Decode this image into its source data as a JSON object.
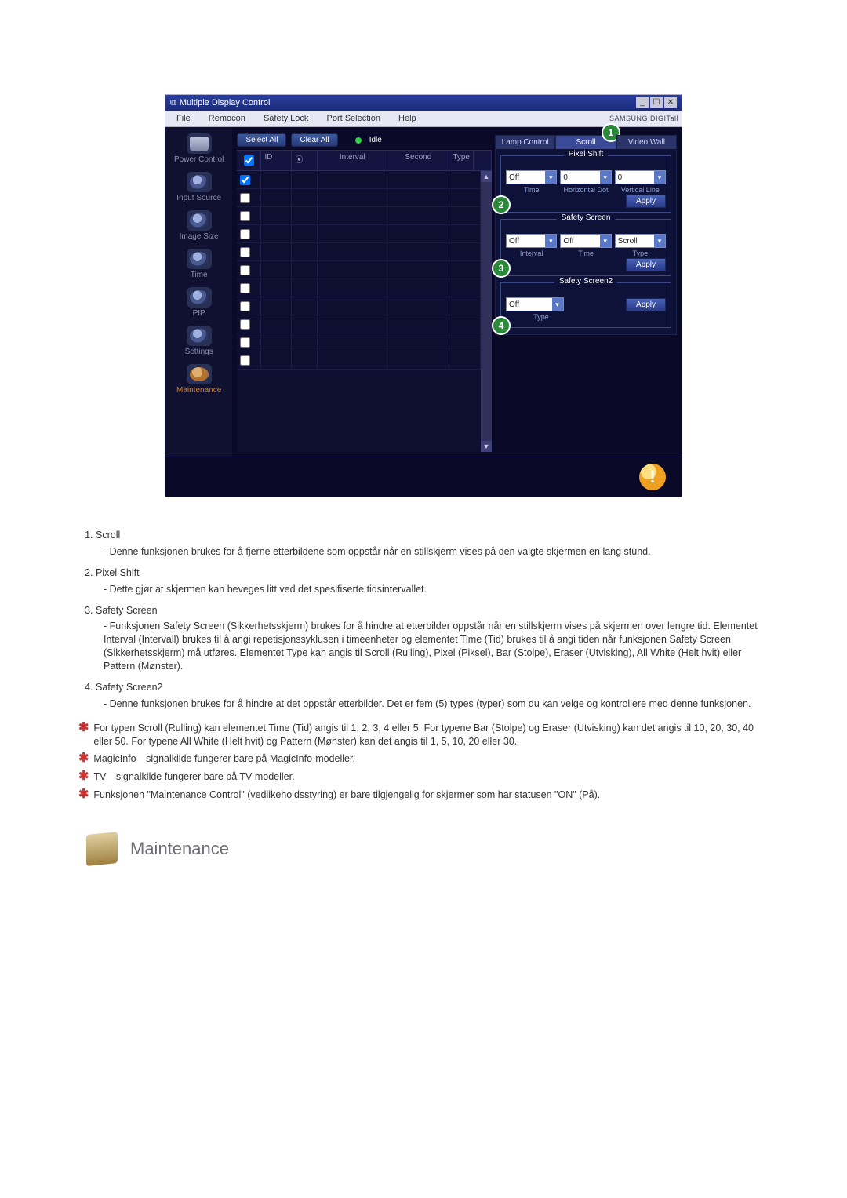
{
  "window": {
    "title": "Multiple Display Control",
    "sysbuttons": [
      "_",
      "☐",
      "✕"
    ]
  },
  "menu": {
    "items": [
      "File",
      "Remocon",
      "Safety Lock",
      "Port Selection",
      "Help"
    ],
    "brand": "SAMSUNG DIGITall"
  },
  "sidebar": {
    "items": [
      {
        "label": "Power Control"
      },
      {
        "label": "Input Source"
      },
      {
        "label": "Image Size"
      },
      {
        "label": "Time"
      },
      {
        "label": "PIP"
      },
      {
        "label": "Settings"
      },
      {
        "label": "Maintenance"
      }
    ]
  },
  "toolbar": {
    "select_all": "Select All",
    "clear_all": "Clear All",
    "status": "Idle"
  },
  "grid": {
    "headers": {
      "id": "ID",
      "interval": "Interval",
      "second": "Second",
      "type": "Type"
    },
    "row_count": 11,
    "first_row_checked": true
  },
  "tabs": {
    "items": [
      "Lamp Control",
      "Scroll",
      "Video Wall"
    ],
    "active": 1,
    "callout": "1"
  },
  "pixel_shift": {
    "title": "Pixel Shift",
    "v1": "Off",
    "v2": "0",
    "v3": "0",
    "l1": "Time",
    "l2": "Horizontal Dot",
    "l3": "Vertical Line",
    "apply": "Apply",
    "callout": "2"
  },
  "safety_screen": {
    "title": "Safety Screen",
    "v1": "Off",
    "v2": "Off",
    "v3": "Scroll",
    "l1": "Interval",
    "l2": "Time",
    "l3": "Type",
    "apply": "Apply",
    "callout": "3"
  },
  "safety_screen2": {
    "title": "Safety Screen2",
    "v1": "Off",
    "l1": "Type",
    "apply": "Apply",
    "callout": "4"
  },
  "doc": {
    "items": [
      {
        "title": "Scroll",
        "desc": "- Denne funksjonen brukes for å fjerne etterbildene som oppstår når en stillskjerm vises på den valgte skjermen en lang stund."
      },
      {
        "title": "Pixel Shift",
        "desc": "- Dette gjør at skjermen kan beveges litt ved det spesifiserte tidsintervallet."
      },
      {
        "title": "Safety Screen",
        "desc": "- Funksjonen Safety Screen (Sikkerhetsskjerm) brukes for å hindre at etterbilder oppstår når en stillskjerm vises på skjermen over lengre tid.  Elementet Interval (Intervall) brukes til å angi repetisjonssyklusen i timeenheter og elementet Time (Tid) brukes til å angi tiden når funksjonen Safety Screen (Sikkerhetsskjerm) må utføres. Elementet Type kan angis til Scroll (Rulling), Pixel (Piksel), Bar (Stolpe), Eraser (Utvisking), All White (Helt hvit) eller Pattern (Mønster)."
      },
      {
        "title": "Safety Screen2",
        "desc": "- Denne funksjonen brukes for å hindre at det oppstår etterbilder. Det er fem (5) types (typer) som du kan velge og kontrollere med denne funksjonen."
      }
    ],
    "notes": [
      "For typen Scroll (Rulling) kan elementet Time (Tid) angis til 1, 2, 3, 4 eller 5. For typene Bar (Stolpe) og Eraser (Utvisking) kan det angis til 10, 20, 30, 40 eller 50. For typene All White (Helt hvit) og Pattern (Mønster) kan det angis til 1, 5, 10, 20 eller 30.",
      "MagicInfo—signalkilde fungerer bare på MagicInfo-modeller.",
      "TV—signalkilde fungerer bare på TV-modeller.",
      "Funksjonen \"Maintenance Control\" (vedlikeholdsstyring) er bare tilgjengelig for skjermer som har statusen \"ON\" (På)."
    ],
    "section_title": "Maintenance"
  }
}
